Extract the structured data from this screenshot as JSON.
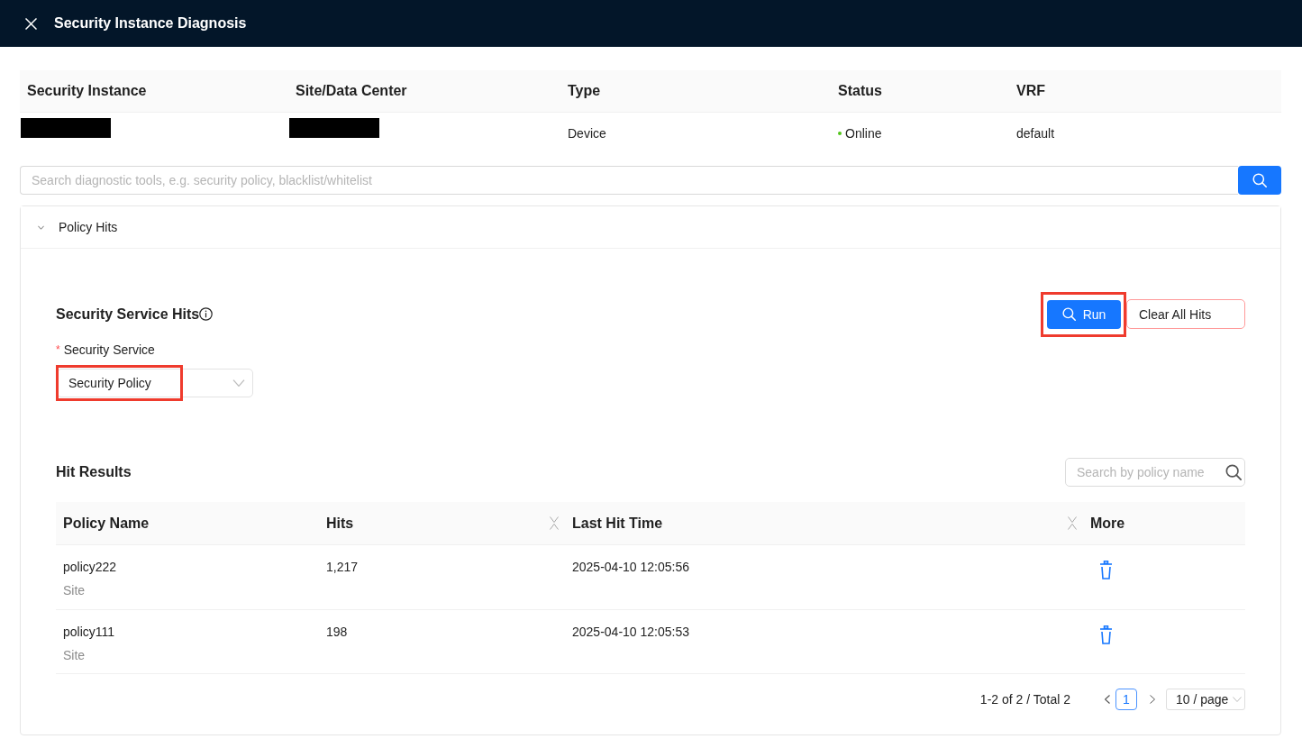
{
  "header": {
    "title": "Security Instance Diagnosis"
  },
  "instance_table": {
    "columns": [
      "Security Instance",
      "Site/Data Center",
      "Type",
      "Status",
      "VRF"
    ],
    "rows": [
      {
        "cells": [
          {
            "kind": "redacted"
          },
          {
            "kind": "redacted"
          },
          {
            "kind": "text",
            "text": "Device"
          },
          {
            "kind": "status",
            "text": "Online",
            "color": "#52c41a"
          },
          {
            "kind": "text",
            "text": "default"
          }
        ]
      }
    ]
  },
  "search": {
    "placeholder": "Search diagnostic tools, e.g. security policy, blacklist/whitelist"
  },
  "panel": {
    "title": "Policy Hits",
    "expanded": true,
    "section_title": "Security Service Hits",
    "run_button": {
      "label": "Run",
      "highlighted": true
    },
    "clear_button": {
      "label": "Clear All Hits"
    },
    "service_field": {
      "required_mark": "*",
      "label": "Security Service",
      "value": "Security Policy",
      "highlighted": true
    },
    "results": {
      "title": "Hit Results",
      "search": {
        "placeholder": "Search by policy name"
      },
      "columns": [
        {
          "label": "Policy Name",
          "sortable": false
        },
        {
          "label": "Hits",
          "sortable": true
        },
        {
          "label": "Last Hit Time",
          "sortable": true
        },
        {
          "label": "More",
          "sortable": false
        }
      ],
      "rows": [
        {
          "policy_name": "policy222",
          "scope": "Site",
          "hits": "1,217",
          "last_hit_time": "2025-04-10 12:05:56"
        },
        {
          "policy_name": "policy111",
          "scope": "Site",
          "hits": "198",
          "last_hit_time": "2025-04-10 12:05:53"
        }
      ],
      "pagination": {
        "summary": "1-2 of 2 / Total 2",
        "pages": [
          {
            "label": "1",
            "selected": true
          }
        ],
        "page_size": "10 / page"
      }
    }
  }
}
